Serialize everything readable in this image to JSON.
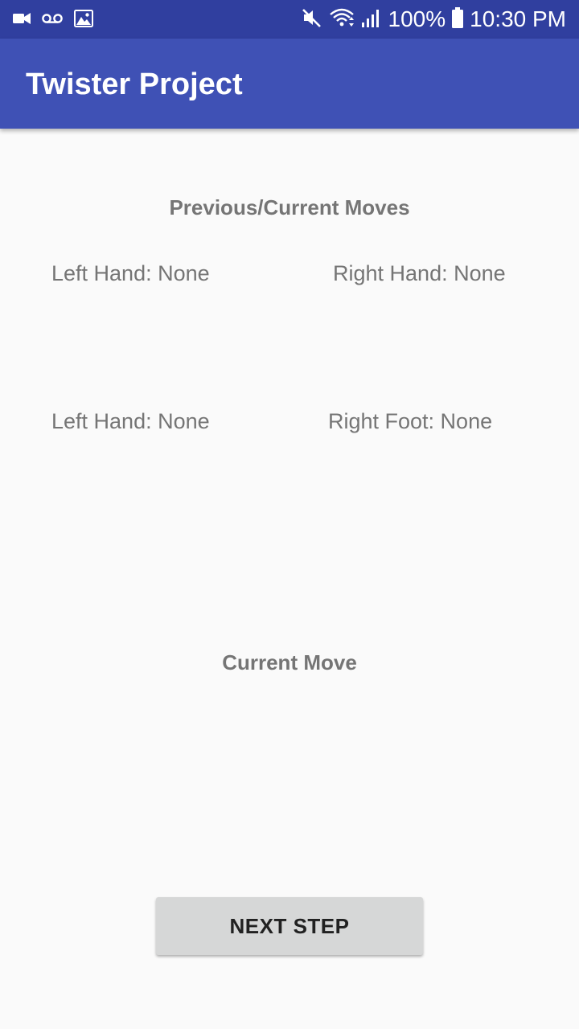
{
  "status_bar": {
    "battery_percent": "100%",
    "time": "10:30 PM",
    "icons": [
      "video-camera-icon",
      "voicemail-icon",
      "image-icon",
      "mute-icon",
      "wifi-icon",
      "signal-icon",
      "battery-icon"
    ]
  },
  "app_bar": {
    "title": "Twister Project"
  },
  "previous_moves": {
    "heading": "Previous/Current Moves",
    "row1_left": "Left Hand: None",
    "row1_right": "Right Hand: None",
    "row2_left": "Left Hand: None",
    "row2_right": "Right Foot: None"
  },
  "current_move": {
    "heading": "Current Move"
  },
  "actions": {
    "next_step_label": "NEXT STEP"
  },
  "colors": {
    "status_bar": "#303f9f",
    "app_bar": "#3f51b5",
    "background": "#fafafa",
    "text_secondary": "#757575",
    "button": "#d6d7d7"
  }
}
